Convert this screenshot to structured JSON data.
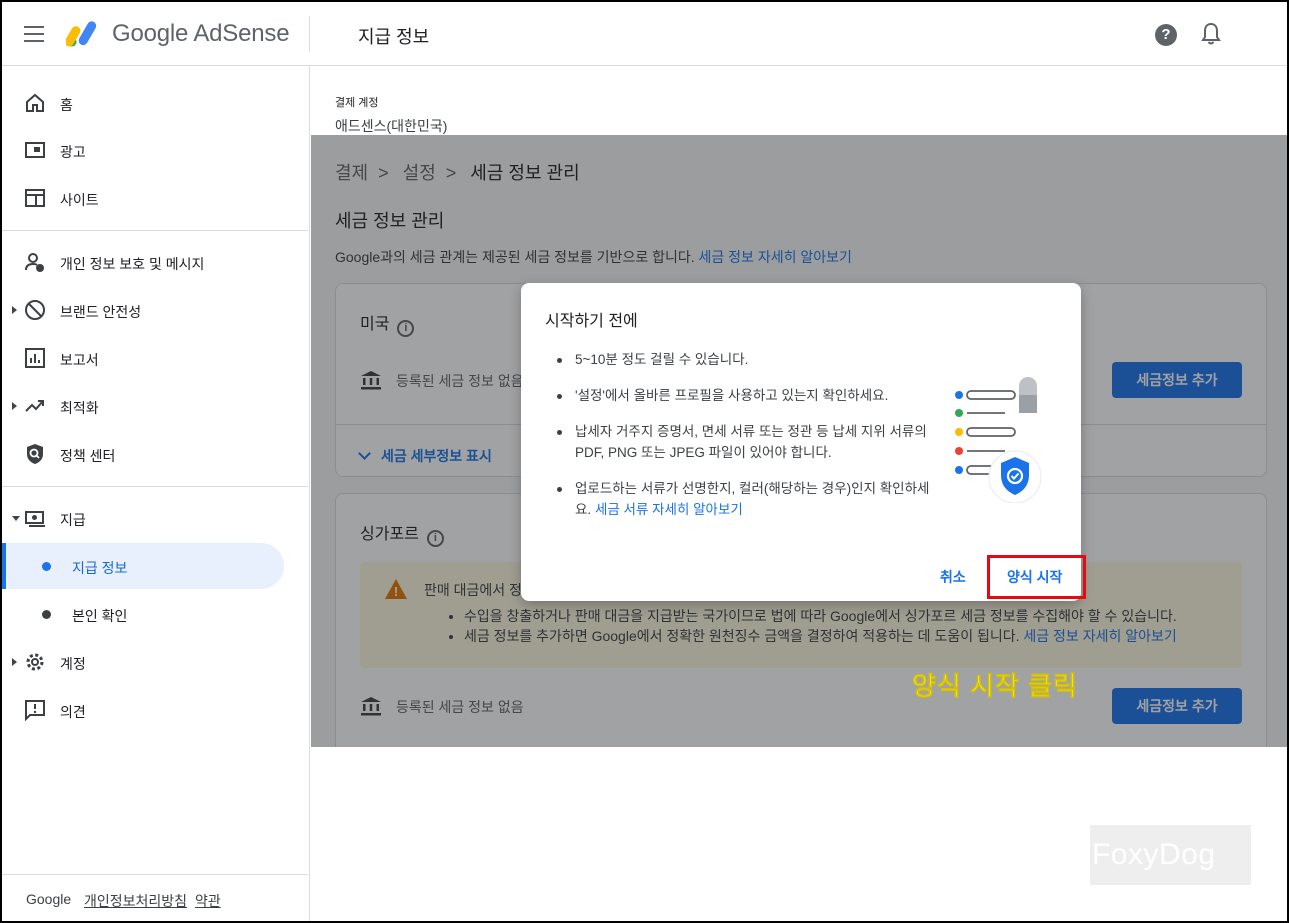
{
  "header": {
    "brand": "Google AdSense",
    "page_heading": "지급 정보",
    "help_icon": "help-icon",
    "help_glyph": "?",
    "notifications_icon": "bell-icon"
  },
  "sidebar": {
    "items": [
      {
        "label": "홈",
        "icon": "home-icon"
      },
      {
        "label": "광고",
        "icon": "ads-icon"
      },
      {
        "label": "사이트",
        "icon": "sites-icon"
      },
      {
        "label": "개인 정보 보호 및 메시지",
        "icon": "privacy-icon"
      },
      {
        "label": "브랜드 안전성",
        "icon": "block-icon"
      },
      {
        "label": "보고서",
        "icon": "reports-icon"
      },
      {
        "label": "최적화",
        "icon": "trending-icon"
      },
      {
        "label": "정책 센터",
        "icon": "shield-search-icon"
      },
      {
        "label": "지급",
        "icon": "payments-icon"
      },
      {
        "label": "계정",
        "icon": "gear-icon"
      },
      {
        "label": "의견",
        "icon": "feedback-icon"
      }
    ],
    "payment_subitems": [
      {
        "label": "지급 정보",
        "active": true
      },
      {
        "label": "본인 확인",
        "active": false
      }
    ],
    "footer": {
      "google": "Google",
      "privacy": "개인정보처리방침",
      "terms": "약관"
    }
  },
  "main": {
    "account_label": "결제 계정",
    "account_name": "애드센스(대한민국)",
    "breadcrumb": [
      "결제",
      "설정",
      "세금 정보 관리"
    ],
    "breadcrumb_sep": ">",
    "section_title": "세금 정보 관리",
    "section_desc": "Google과의 세금 관계는 제공된 세금 정보를 기반으로 합니다.",
    "section_link": "세금 정보 자세히 알아보기",
    "us_card": {
      "title": "미국",
      "info_glyph": "i",
      "status": "등록된 세금 정보 없음",
      "add_button": "세금정보 추가",
      "expand_label": "세금 세부정보 표시"
    },
    "sg_card": {
      "title": "싱가포르",
      "info_glyph": "i",
      "warning_title": "판매 대금에서 정",
      "warning_icon_glyph": "!",
      "warning_items": [
        "수입을 창출하거나 판매 대금을 지급받는 국가이므로 법에 따라 Google에서 싱가포르 세금 정보를 수집해야 할 수 있습니다.",
        "세금 정보를 추가하면 Google에서 정확한 원천징수 금액을 결정하여 적용하는 데 도움이 됩니다."
      ],
      "warning_link": "세금 정보 자세히 알아보기",
      "status": "등록된 세금 정보 없음",
      "add_button": "세금정보 추가"
    }
  },
  "dialog": {
    "title": "시작하기 전에",
    "bullets": [
      "5~10분 정도 걸릴 수 있습니다.",
      "'설정'에서 올바른 프로필을 사용하고 있는지 확인하세요.",
      "납세자 거주지 증명서, 면세 서류 또는 정관 등 납세 지위 서류의 PDF, PNG 또는 JPEG 파일이 있어야 합니다.",
      "업로드하는 서류가 선명한지, 컬러(해당하는 경우)인지 확인하세요."
    ],
    "bullet_link": "세금 서류 자세히 알아보기",
    "cancel": "취소",
    "start": "양식 시작"
  },
  "annotation": "양식 시작 클릭",
  "watermark": "FoxyDog",
  "colors": {
    "accent": "#1a73e8",
    "highlight_box": "#e50914",
    "annotation_text": "#ffeb3b",
    "warning_bg": "#fef7e0"
  }
}
